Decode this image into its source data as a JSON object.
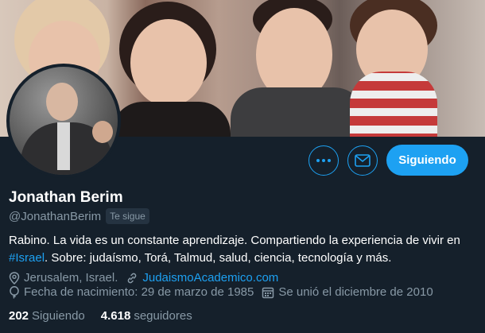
{
  "profile": {
    "display_name": "Jonathan Berim",
    "handle": "@JonathanBerim",
    "follows_you": "Te sigue"
  },
  "bio": {
    "text_before": "Rabino. La vida es un constante aprendizaje. Compartiendo la experiencia de vivir en ",
    "hashtag": "#Israel",
    "text_after": ". Sobre: judaísmo, Torá, Talmud, salud, ciencia, tecnología y más."
  },
  "meta": {
    "location": "Jerusalem, Israel.",
    "website": "JudaismoAcademico.com",
    "birthday": "Fecha de nacimiento: 29 de marzo de 1985",
    "joined": "Se unió el diciembre de 2010"
  },
  "stats": {
    "following_count": "202",
    "following_label": "Siguiendo",
    "followers_count": "4.618",
    "followers_label": "seguidores"
  },
  "actions": {
    "more_icon": "more-icon",
    "message_icon": "envelope-icon",
    "follow_label": "Siguiendo"
  },
  "colors": {
    "background": "#15202b",
    "accent": "#1da1f2",
    "muted": "#8899a6"
  }
}
